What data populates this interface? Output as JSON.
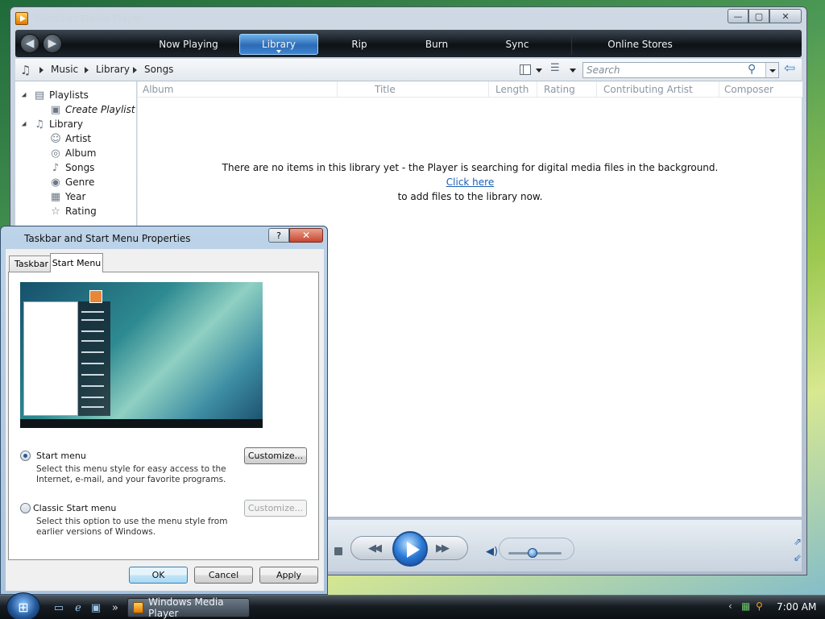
{
  "wmp": {
    "title": "Windows Media Player",
    "controls": {
      "minimize": "—",
      "maximize": "▢",
      "close": "✕"
    },
    "tabs": [
      "Now Playing",
      "Library",
      "Rip",
      "Burn",
      "Sync",
      "Online Stores"
    ],
    "breadcrumb": [
      "Music",
      "Library",
      "Songs"
    ],
    "search_placeholder": "Search",
    "columns": [
      "Album",
      "Title",
      "Length",
      "Rating",
      "Contributing Artist",
      "Composer"
    ],
    "nav": {
      "playlists": "Playlists",
      "create_playlist": "Create Playlist",
      "library": "Library",
      "artist": "Artist",
      "album": "Album",
      "songs": "Songs",
      "genre": "Genre",
      "year": "Year",
      "rating": "Rating"
    },
    "empty_message": {
      "line1": "There are no items in this library yet - the Player is searching for digital media files in the background.",
      "link": "Click here",
      "line3": "to add files to the library now."
    }
  },
  "dialog": {
    "title": "Taskbar and Start Menu Properties",
    "help": "?",
    "close": "✕",
    "tabs": [
      "Taskbar",
      "Start Menu"
    ],
    "options": {
      "start_menu": {
        "label": "Start menu",
        "desc1": "Select this menu style for easy access to the",
        "desc2": "Internet, e-mail, and your favorite programs.",
        "button": "Customize..."
      },
      "classic": {
        "label": "Classic Start menu",
        "desc1": "Select this option to use the menu style from",
        "desc2": "earlier versions of Windows.",
        "button": "Customize..."
      }
    },
    "buttons": {
      "ok": "OK",
      "cancel": "Cancel",
      "apply": "Apply"
    }
  },
  "taskbar": {
    "window_button": "Windows Media Player",
    "clock": "7:00 AM",
    "overflow": "»"
  }
}
